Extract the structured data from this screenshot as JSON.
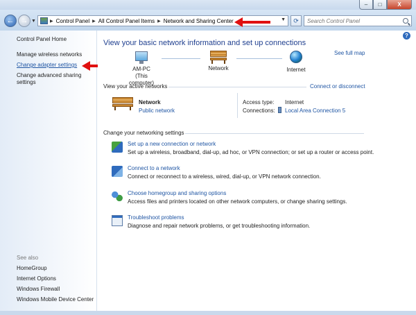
{
  "window": {
    "minimize_glyph": "–",
    "maximize_glyph": "□",
    "close_glyph": "X"
  },
  "address": {
    "crumbs": [
      "Control Panel",
      "All Control Panel Items",
      "Network and Sharing Center"
    ],
    "search_placeholder": "Search Control Panel"
  },
  "sidebar": {
    "home": "Control Panel Home",
    "links": [
      "Manage wireless networks",
      "Change adapter settings",
      "Change advanced sharing",
      "settings"
    ],
    "see_also_label": "See also",
    "see_also": [
      "HomeGroup",
      "Internet Options",
      "Windows Firewall",
      "Windows Mobile Device Center"
    ]
  },
  "main": {
    "title": "View your basic network information and set up connections",
    "see_full_map": "See full map",
    "map": {
      "computer_name": "AM-PC",
      "computer_sub": "(This computer)",
      "network": "Network",
      "internet": "Internet"
    },
    "active": {
      "label": "View your active networks",
      "connect_link": "Connect or disconnect",
      "network_name": "Network",
      "network_type": "Public network",
      "access_type_label": "Access type:",
      "access_type_value": "Internet",
      "connections_label": "Connections:",
      "connections_value": "Local Area Connection 5"
    },
    "settings_label": "Change your networking settings",
    "tasks": [
      {
        "title": "Set up a new connection or network",
        "desc": "Set up a wireless, broadband, dial-up, ad hoc, or VPN connection; or set up a router or access point."
      },
      {
        "title": "Connect to a network",
        "desc": "Connect or reconnect to a wireless, wired, dial-up, or VPN network connection."
      },
      {
        "title": "Choose homegroup and sharing options",
        "desc": "Access files and printers located on other network computers, or change sharing settings."
      },
      {
        "title": "Troubleshoot problems",
        "desc": "Diagnose and repair network problems, or get troubleshooting information."
      }
    ]
  },
  "colors": {
    "link": "#1f55a3",
    "title": "#1f3f8f",
    "annotation_arrow": "#e01010"
  }
}
